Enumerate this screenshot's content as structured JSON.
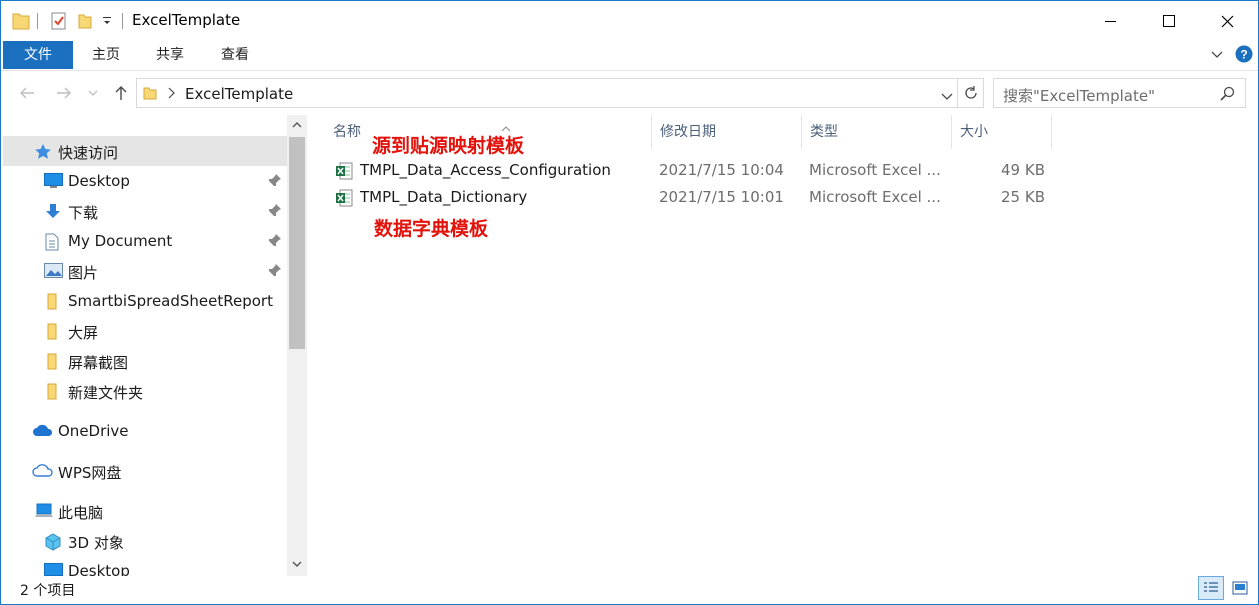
{
  "window": {
    "title": "ExcelTemplate"
  },
  "ribbon": {
    "tabs": [
      {
        "label": "文件"
      },
      {
        "label": "主页"
      },
      {
        "label": "共享"
      },
      {
        "label": "查看"
      }
    ]
  },
  "address": {
    "path": "ExcelTemplate",
    "search_placeholder": "搜索\"ExcelTemplate\""
  },
  "sidebar": {
    "items": [
      {
        "label": "快速访问",
        "icon": "star-icon"
      },
      {
        "label": "Desktop",
        "icon": "desktop-icon",
        "pinned": true
      },
      {
        "label": "下载",
        "icon": "download-icon",
        "pinned": true
      },
      {
        "label": "My Document",
        "icon": "document-icon",
        "pinned": true
      },
      {
        "label": "图片",
        "icon": "pictures-icon",
        "pinned": true
      },
      {
        "label": "SmartbiSpreadSheetReport",
        "icon": "folder-icon"
      },
      {
        "label": "大屏",
        "icon": "folder-icon"
      },
      {
        "label": "屏幕截图",
        "icon": "folder-icon"
      },
      {
        "label": "新建文件夹",
        "icon": "folder-icon"
      },
      {
        "label": "OneDrive",
        "icon": "onedrive-icon"
      },
      {
        "label": "WPS网盘",
        "icon": "cloud-icon"
      },
      {
        "label": "此电脑",
        "icon": "computer-icon"
      },
      {
        "label": "3D 对象",
        "icon": "cube-icon"
      },
      {
        "label": "Desktop",
        "icon": "desktop-icon"
      }
    ]
  },
  "list": {
    "columns": [
      {
        "label": "名称"
      },
      {
        "label": "修改日期"
      },
      {
        "label": "类型"
      },
      {
        "label": "大小"
      }
    ],
    "files": [
      {
        "name": "TMPL_Data_Access_Configuration",
        "date": "2021/7/15 10:04",
        "type": "Microsoft Excel ...",
        "size": "49 KB"
      },
      {
        "name": "TMPL_Data_Dictionary",
        "date": "2021/7/15 10:01",
        "type": "Microsoft Excel ...",
        "size": "25 KB"
      }
    ],
    "annotations": [
      {
        "text": "源到贴源映射模板"
      },
      {
        "text": "数据字典模板"
      }
    ]
  },
  "status": {
    "item_count": "2 个项目"
  },
  "colors": {
    "accent": "#1a6fbf",
    "annotation": "#e3120b",
    "selected_bg": "#e5e5e5"
  }
}
